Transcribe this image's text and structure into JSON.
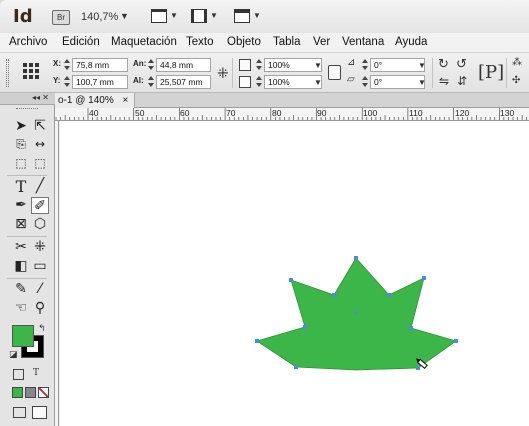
{
  "app": {
    "logo_text": "Id",
    "bridge_label": "Br",
    "zoom_level": "140,7%",
    "zoom_arrow": "▼"
  },
  "menu": {
    "items": [
      "Archivo",
      "Edición",
      "Maquetación",
      "Texto",
      "Objeto",
      "Tabla",
      "Ver",
      "Ventana",
      "Ayuda"
    ]
  },
  "control": {
    "x_label": "X:",
    "x_value": "75,8 mm",
    "y_label": "Y:",
    "y_value": "100,7 mm",
    "w_label": "An:",
    "w_value": "44,8 mm",
    "h_label": "Al:",
    "h_value": "25,507 mm",
    "scale_x": "100%",
    "scale_y": "100%",
    "angle_rotate": "0°",
    "angle_shear": "0°"
  },
  "tools_panel": {
    "collapse_label": "◂◂ ✕"
  },
  "document": {
    "tab_label": "o-1 @ 140%",
    "tab_close": "×"
  },
  "ruler": {
    "ticks": [
      "40",
      "50",
      "60",
      "70",
      "80",
      "90",
      "100",
      "110",
      "120",
      "130"
    ]
  },
  "colors": {
    "fill": "#3db649",
    "stroke": "#000000",
    "selection": "#4a8fd6",
    "accent_none": "#d22222"
  },
  "shape": {
    "type": "star",
    "fill": "#3db649",
    "points": 7
  }
}
